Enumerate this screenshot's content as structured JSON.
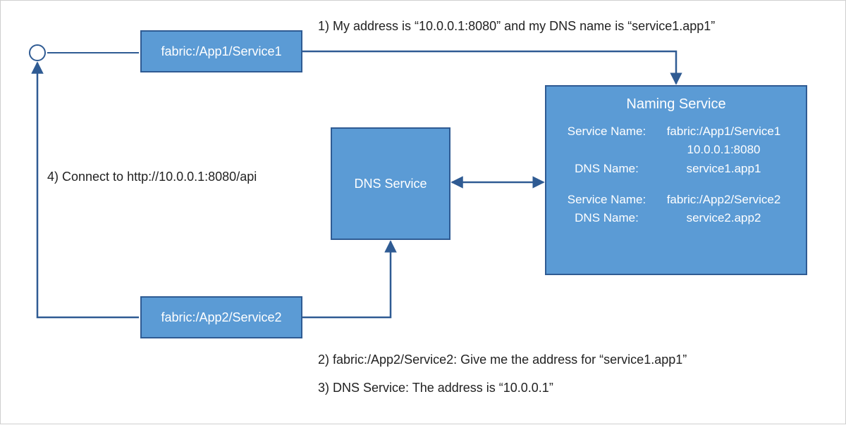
{
  "colors": {
    "fill": "#5b9bd5",
    "stroke": "#2f5b93"
  },
  "boxes": {
    "service1": {
      "label": "fabric:/App1/Service1"
    },
    "service2": {
      "label": "fabric:/App2/Service2"
    },
    "dns": {
      "label": "DNS Service"
    },
    "naming": {
      "title": "Naming Service",
      "rows": [
        {
          "k": "Service Name:",
          "v": "fabric:/App1/Service1"
        },
        {
          "k": "",
          "v": "10.0.0.1:8080"
        },
        {
          "k": "DNS Name:",
          "v": "service1.app1"
        }
      ],
      "rows2": [
        {
          "k": "Service Name:",
          "v": "fabric:/App2/Service2"
        },
        {
          "k": "DNS Name:",
          "v": "service2.app2"
        }
      ]
    }
  },
  "labels": {
    "step1": "1) My address is “10.0.0.1:8080” and my DNS name is “service1.app1”",
    "step2": "2) fabric:/App2/Service2: Give me the address for “service1.app1”",
    "step3": "3) DNS Service: The address is “10.0.0.1”",
    "step4": "4) Connect to http://10.0.0.1:8080/api"
  }
}
